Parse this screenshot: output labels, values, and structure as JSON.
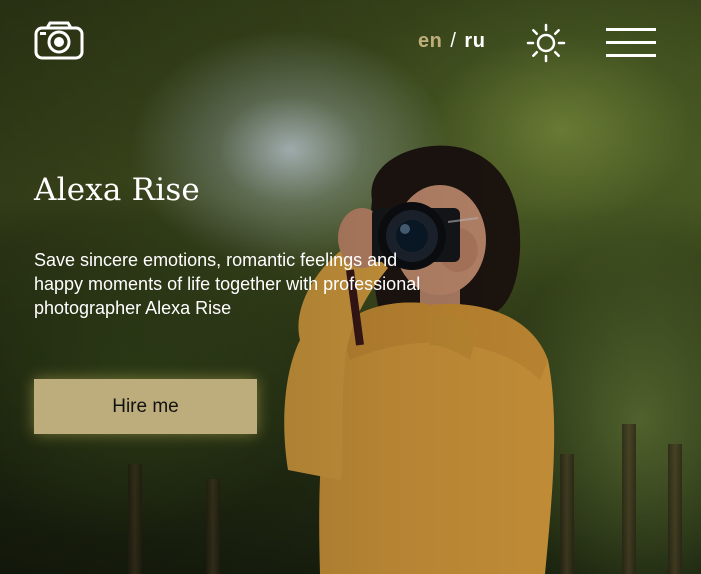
{
  "header": {
    "logo_icon": "camera-icon",
    "lang_en": "en",
    "lang_separator": "/",
    "lang_ru": "ru",
    "theme_icon": "sun-icon",
    "menu_icon": "hamburger-menu-icon"
  },
  "hero": {
    "title": "Alexa Rise",
    "description": "Save sincere emotions, romantic feelings and happy moments of life together with professional photographer Alexa Rise",
    "hire_label": "Hire me"
  },
  "colors": {
    "accent": "#bdad7c",
    "active_lang": "#bfae79",
    "text": "#ffffff"
  }
}
